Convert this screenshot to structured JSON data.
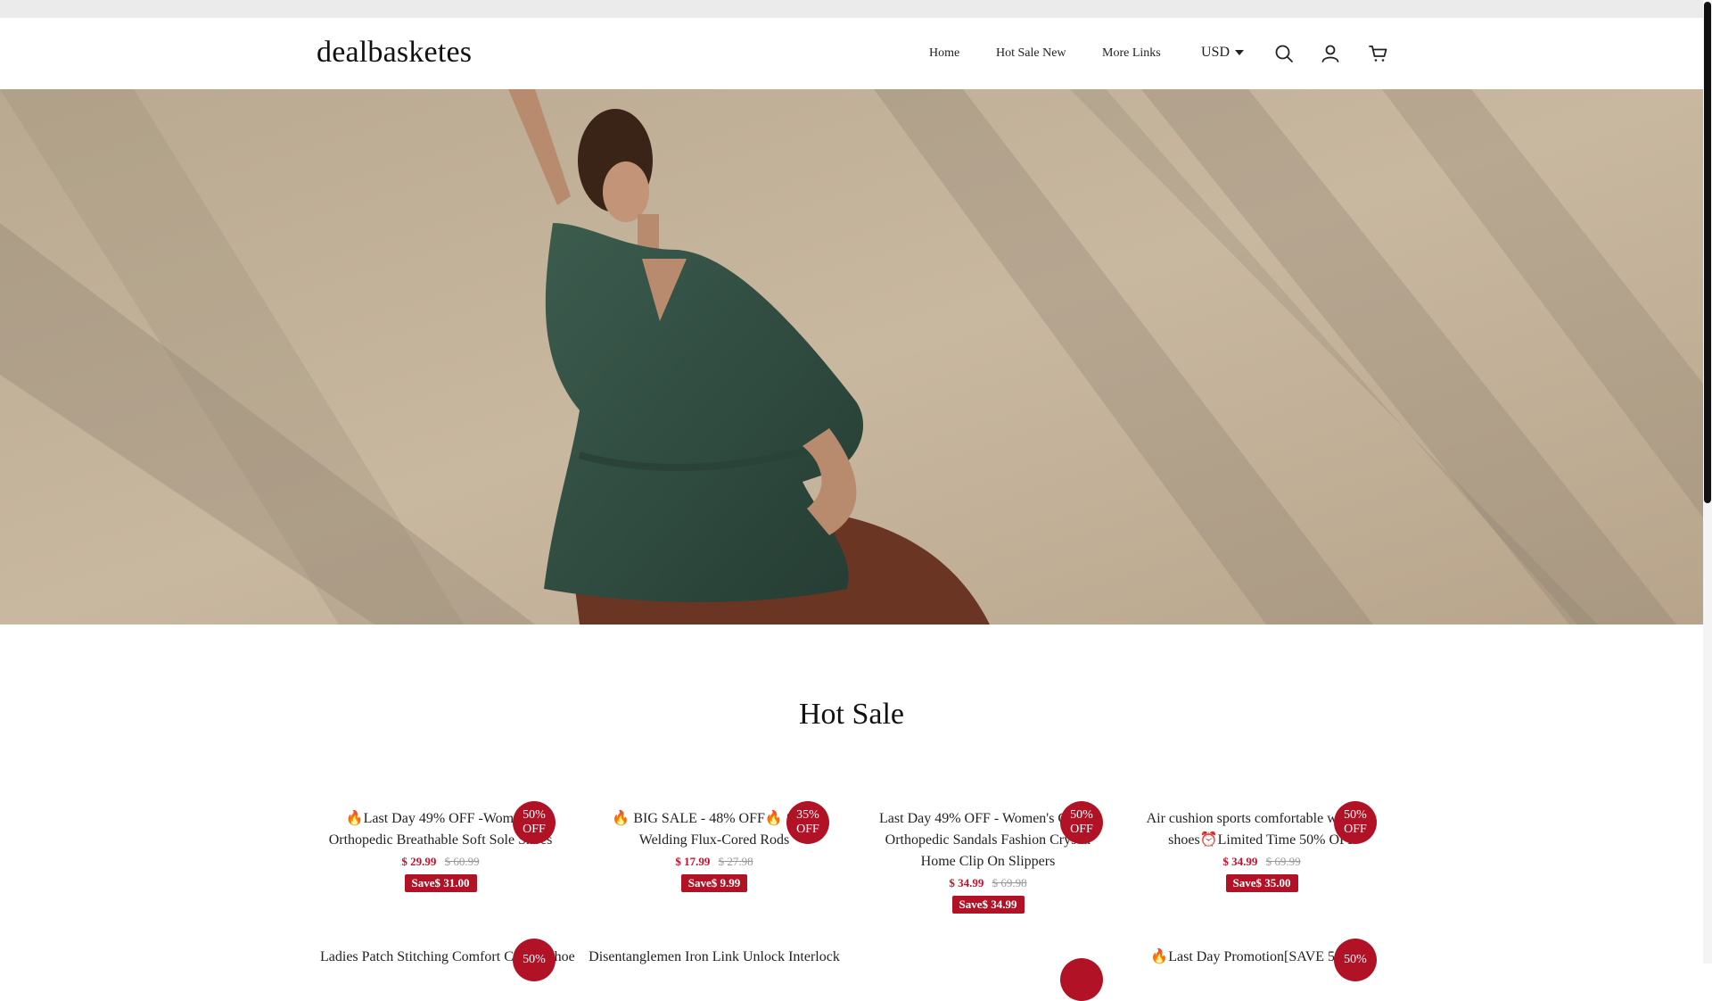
{
  "header": {
    "logo": "dealbasketes",
    "nav": [
      "Home",
      "Hot Sale New",
      "More Links"
    ],
    "currency": "USD",
    "icons": [
      "search-icon",
      "account-icon",
      "cart-icon"
    ]
  },
  "hero": {
    "image": "woman-green-blouse-hero"
  },
  "section": {
    "title": "Hot Sale"
  },
  "products": [
    {
      "title": "🔥Last Day 49% OFF -Women's Orthopedic Breathable Soft Sole Shoes",
      "price": "$ 29.99",
      "compare": "$ 60.99",
      "save": "Save$ 31.00",
      "badge_top": "50%",
      "badge_bottom": "OFF"
    },
    {
      "title": "🔥 BIG SALE - 48% OFF🔥 Solid Welding Flux-Cored Rods",
      "price": "$ 17.99",
      "compare": "$ 27.98",
      "save": "Save$ 9.99",
      "badge_top": "35%",
      "badge_bottom": "OFF"
    },
    {
      "title": "Last Day 49% OFF - Women's Casual Orthopedic Sandals Fashion Crystal Home Clip On Slippers",
      "price": "$ 34.99",
      "compare": "$ 69.98",
      "save": "Save$ 34.99",
      "badge_top": "50%",
      "badge_bottom": "OFF"
    },
    {
      "title": "Air cushion sports comfortable women's shoes⏰Limited Time 50% OFF",
      "price": "$ 34.99",
      "compare": "$ 69.99",
      "save": "Save$ 35.00",
      "badge_top": "50%",
      "badge_bottom": "OFF"
    },
    {
      "title": "Ladies Patch Stitching Comfort Casual Shoe",
      "badge_top": "50%"
    },
    {
      "title": "Disentanglemen Iron Link Unlock Interlock"
    },
    {
      "title": ""
    },
    {
      "title": "🔥Last Day Promotion[SAVE 50%]---",
      "badge_top": "50%"
    }
  ],
  "colors": {
    "accent": "#b11226",
    "price": "#c8102e"
  }
}
